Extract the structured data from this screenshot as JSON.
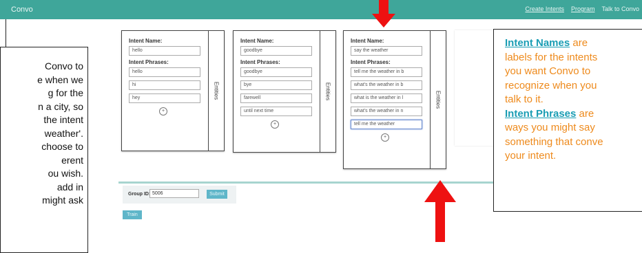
{
  "topbar": {
    "brand": "Convo",
    "nav": [
      "Create Intents",
      "Program",
      "Talk to Convo"
    ]
  },
  "cards": [
    {
      "name_label": "Intent Name:",
      "name_value": "hello",
      "phrases_label": "Intent Phrases:",
      "phrases": [
        "hello",
        "hi",
        "hey"
      ],
      "side_label": "Entities",
      "add_symbol": "+"
    },
    {
      "name_label": "Intent Name:",
      "name_value": "goodbye",
      "phrases_label": "Intent Phrases:",
      "phrases": [
        "goodbye",
        "bye",
        "farewell",
        "until next time"
      ],
      "side_label": "Entities",
      "add_symbol": "+"
    },
    {
      "name_label": "Intent Name:",
      "name_value": "say the weather",
      "phrases_label": "Intent Phrases:",
      "phrases": [
        "tell me the weather in b",
        "what's the weather in b",
        "what is the weather in l",
        "what's the weather in n",
        "tell me the weather"
      ],
      "side_label": "Entities",
      "add_symbol": "+"
    }
  ],
  "group": {
    "label": "Group ID:",
    "value": "5006",
    "submit": "Submit"
  },
  "train_button": "Train",
  "left_note": [
    "Convo to",
    "e when we",
    "g for the",
    "n a city, so",
    "the intent",
    "weather'.",
    "choose to",
    "erent",
    "ou wish.",
    "add in",
    "might ask"
  ],
  "right_note": {
    "l1_b": "Intent Names",
    "l1_t": " are",
    "l2": "labels for the intents",
    "l3": "you want Convo to",
    "l4": "recognize when you",
    "l5": "talk to it.",
    "l6_b": "Intent Phrases",
    "l6_t": " are",
    "l7": "ways you might say",
    "l8": "something that conve",
    "l9": "your intent."
  },
  "colors": {
    "topbar": "#3fa69a",
    "accent_button": "#5fb6c9",
    "note_text": "#ee8a1c",
    "note_link": "#1a9db4",
    "arrow": "#ee1111"
  }
}
